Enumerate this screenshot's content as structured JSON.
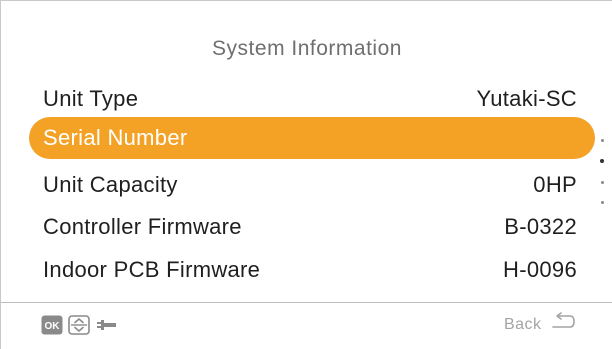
{
  "screen": {
    "title": "System Information",
    "rows": [
      {
        "label": "Unit Type",
        "value": "Yutaki-SC",
        "selected": false
      },
      {
        "label": "Serial Number",
        "value": "",
        "selected": true
      },
      {
        "label": "Unit Capacity",
        "value": "0HP",
        "selected": false
      },
      {
        "label": "Controller Firmware",
        "value": "B-0322",
        "selected": false
      },
      {
        "label": "Indoor PCB Firmware",
        "value": "H-0096",
        "selected": false
      }
    ]
  },
  "footer": {
    "icons": [
      "ok-icon",
      "up-down-arrows-icon",
      "wrench-icon"
    ],
    "ok_label": "OK",
    "back_label": "Back",
    "back_icon": "return-arrow-icon"
  },
  "colors": {
    "highlight": "#f4a225",
    "text": "#1f1f1f",
    "title": "#6f6f6f",
    "muted": "#a4a4a4"
  },
  "scroll": {
    "pages": 4,
    "current_page": 2
  }
}
